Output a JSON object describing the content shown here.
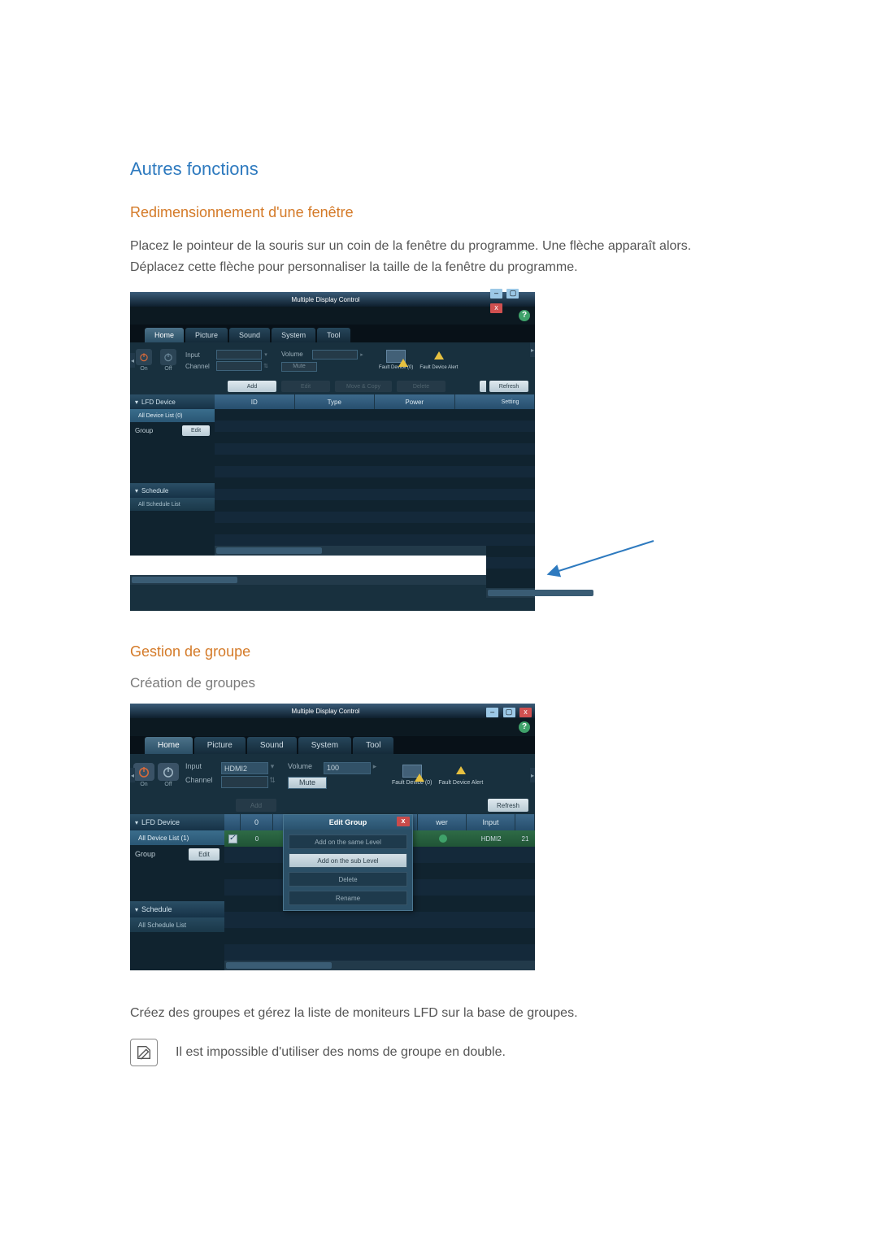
{
  "headings": {
    "other_functions": "Autres fonctions",
    "resize_window": "Redimensionnement d'une fenêtre",
    "group_mgmt": "Gestion de groupe",
    "create_groups": "Création de groupes"
  },
  "paragraphs": {
    "resize": "Placez le pointeur de la souris sur un coin de la fenêtre du programme. Une flèche apparaît alors. Déplacez cette flèche pour personnaliser la taille de la fenêtre du programme.",
    "create": "Créez des groupes et gérez la liste de moniteurs LFD sur la base de groupes.",
    "note": "Il est impossible d'utiliser des noms de groupe en double."
  },
  "app": {
    "title": "Multiple Display Control",
    "tabs": [
      "Home",
      "Picture",
      "Sound",
      "System",
      "Tool"
    ],
    "active_tab": "Home"
  },
  "toolbar": {
    "power_on": "On",
    "power_off": "Off",
    "input_label": "Input",
    "channel_label": "Channel",
    "volume_label": "Volume",
    "mute_label": "Mute",
    "fault_device_n": "Fault Device (0)",
    "fault_alert": "Fault Device Alert"
  },
  "actions": {
    "add": "Add",
    "edit_disabled": "Edit",
    "move_copy": "Move & Copy",
    "delete": "Delete",
    "refresh": "Refresh"
  },
  "sidebar": {
    "lfd_device": "LFD Device",
    "all_device_list0": "All Device List (0)",
    "all_device_list1": "All Device List (1)",
    "group": "Group",
    "edit": "Edit",
    "schedule": "Schedule",
    "all_schedule_list": "All Schedule List"
  },
  "columns1": [
    "ID",
    "Type",
    "Power",
    "Input"
  ],
  "columns2_right": [
    "wer",
    "Input"
  ],
  "columns2_right_hint": "Setting",
  "shot2": {
    "input_value": "HDMI2",
    "volume_value": "100",
    "row_id": "0",
    "row_input": "HDMI2",
    "row_setting": "21"
  },
  "popup": {
    "title": "Edit Group",
    "opt1": "Add on the same Level",
    "opt2": "Add on the sub Level",
    "opt3": "Delete",
    "opt4": "Rename"
  }
}
